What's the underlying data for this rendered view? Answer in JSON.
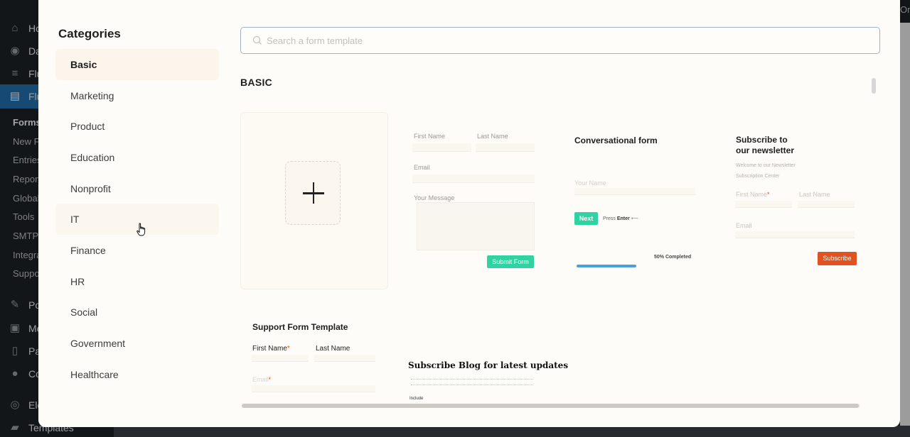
{
  "wp_admin": {
    "top_right_text": "Onl",
    "menu": [
      {
        "label": "Home",
        "icon": "home-icon"
      },
      {
        "label": "Dashboard",
        "icon": "dashboard-icon"
      },
      {
        "label": "Fluent",
        "icon": "fluent-icon"
      },
      {
        "label": "Fluent Forms",
        "icon": "forms-icon"
      },
      {
        "label": "Posts",
        "icon": "pin-icon"
      },
      {
        "label": "Media",
        "icon": "media-icon"
      },
      {
        "label": "Pages",
        "icon": "pages-icon"
      },
      {
        "label": "Comments",
        "icon": "comment-icon"
      },
      {
        "label": "Elementor",
        "icon": "elementor-icon"
      },
      {
        "label": "Templates",
        "icon": "folder-icon"
      }
    ],
    "submenu": [
      "Forms",
      "New Form",
      "Entries",
      "Reports",
      "Global Settings",
      "Tools",
      "SMTP",
      "Integrations",
      "Support"
    ]
  },
  "modal": {
    "categories_title": "Categories",
    "categories": [
      "Basic",
      "Marketing",
      "Product",
      "Education",
      "Nonprofit",
      "IT",
      "Finance",
      "HR",
      "Social",
      "Government",
      "Healthcare"
    ],
    "active_category": "Basic",
    "hovered_category": "IT",
    "search": {
      "placeholder": "Search a form template",
      "value": ""
    },
    "section_title": "BASIC",
    "templates": {
      "contact": {
        "first_name": "First Name",
        "last_name": "Last Name",
        "email": "Email",
        "message": "Your Message",
        "submit": "Submit Form"
      },
      "conversational": {
        "title": "Conversational form",
        "field": "Your Name",
        "next": "Next",
        "press": "Press",
        "enter": "Enter",
        "progress_label": "50% Completed",
        "progress": 0.5
      },
      "newsletter": {
        "title_line1": "Subscribe to",
        "title_line2": "our newsletter",
        "subtitle_line1": "Welcome to our Newsletter",
        "subtitle_line2": "Subscription Center",
        "first_name": "First Name",
        "last_name": "Last Name",
        "email": "Email",
        "subscribe": "Subscribe"
      },
      "support": {
        "title": "Support Form Template",
        "first_name": "First Name",
        "last_name": "Last Name",
        "email": "Email"
      },
      "blog": {
        "title": "Subscribe Blog for latest updates",
        "field_label": "Include"
      }
    },
    "colors": {
      "accent_green": "#2fd3a1",
      "subscribe_orange": "#e0521f",
      "progress_blue": "#4a9fdc"
    }
  }
}
